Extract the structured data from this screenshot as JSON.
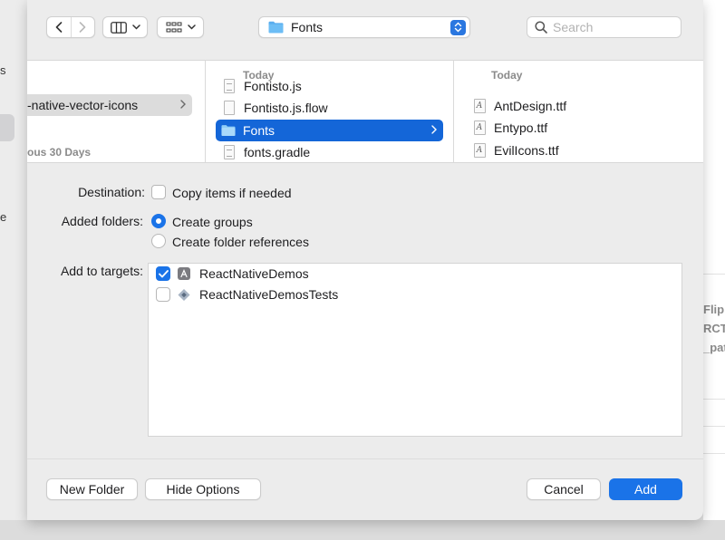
{
  "background_window": {
    "left_fragments": [
      "s",
      "e"
    ],
    "right_fragments": [
      "Flip",
      "RCT",
      "_patl"
    ]
  },
  "toolbar": {
    "path_name": "Fonts",
    "search_placeholder": "Search"
  },
  "browser": {
    "col1": {
      "selected_item": "-native-vector-icons",
      "section_header": "ous 30 Days"
    },
    "col2": {
      "header": "Today",
      "items": [
        {
          "name": "Fontisto.js",
          "icon": "js-file-icon"
        },
        {
          "name": "Fontisto.js.flow",
          "icon": "file-icon"
        },
        {
          "name": "Fonts",
          "icon": "folder-icon",
          "selected": true
        },
        {
          "name": "fonts.gradle",
          "icon": "text-file-icon"
        }
      ]
    },
    "col3": {
      "header": "Today",
      "items": [
        {
          "name": "AntDesign.ttf",
          "icon": "font-file-icon"
        },
        {
          "name": "Entypo.ttf",
          "icon": "font-file-icon"
        },
        {
          "name": "EvilIcons.ttf",
          "icon": "font-file-icon"
        }
      ]
    }
  },
  "options": {
    "destination_label": "Destination:",
    "copy_items_label": "Copy items if needed",
    "copy_items_checked": false,
    "added_folders_label": "Added folders:",
    "create_groups_label": "Create groups",
    "create_folder_refs_label": "Create folder references",
    "selected_folder_option": "Create groups",
    "targets_label": "Add to targets:",
    "targets": [
      {
        "name": "ReactNativeDemos",
        "checked": true,
        "icon": "app-target-icon"
      },
      {
        "name": "ReactNativeDemosTests",
        "checked": false,
        "icon": "test-target-icon"
      }
    ]
  },
  "footer": {
    "new_folder": "New Folder",
    "hide_options": "Hide Options",
    "cancel": "Cancel",
    "add": "Add"
  },
  "colors": {
    "accent": "#1a73e8",
    "selection": "#1466d8",
    "folder": "#5aaeef"
  }
}
